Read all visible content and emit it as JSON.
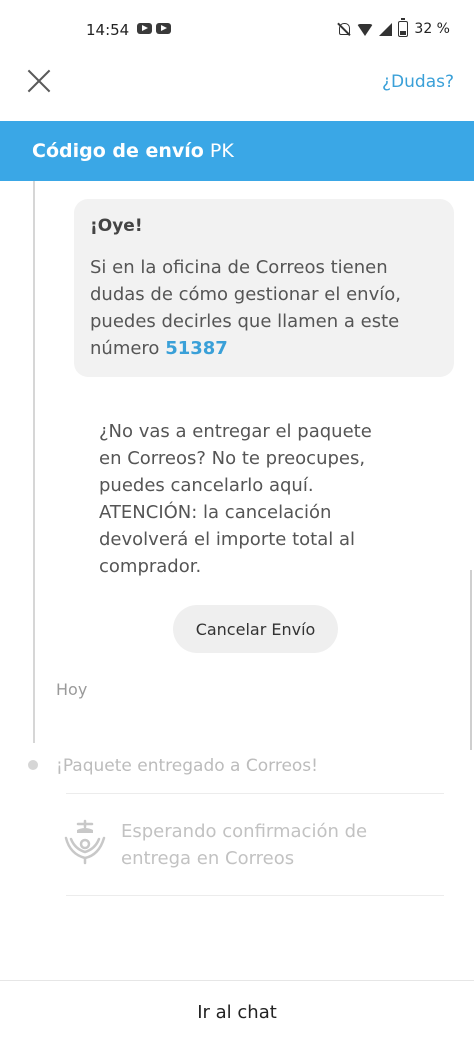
{
  "status_bar": {
    "time": "14:54",
    "battery": "32 %",
    "icons": [
      "youtube-icon",
      "youtube-icon",
      "notifications-off-icon",
      "wifi-icon",
      "signal-icon",
      "battery-icon"
    ]
  },
  "top_nav": {
    "close_icon": "close-icon",
    "help_link": "¿Dudas?"
  },
  "header": {
    "title": "Código de envío",
    "code": "PK",
    "background_color": "#3aa7e6"
  },
  "info_card": {
    "heading": "¡Oye!",
    "body": "Si en la oficina de Correos tienen dudas de cómo gestionar el envío, puedes decirles que llamen a este número",
    "number": "51387"
  },
  "cancel_section": {
    "text": "¿No vas a entregar el paquete en Correos? No te preocupes, puedes cancelarlo aquí. ATENCIÓN: la cancelación devolverá el importe total al comprador.",
    "button_label": "Cancelar Envío"
  },
  "timeline": {
    "today_label": "Hoy",
    "pending_step": "¡Paquete entregado a Correos!",
    "waiting_text": "Esperando confirmación de entrega en Correos",
    "waiting_icon": "correos-post-horn-icon"
  },
  "bottom": {
    "chat_button": "Ir al chat"
  },
  "colors": {
    "accent": "#3aa0d8",
    "muted_text": "#bcbcbc"
  }
}
